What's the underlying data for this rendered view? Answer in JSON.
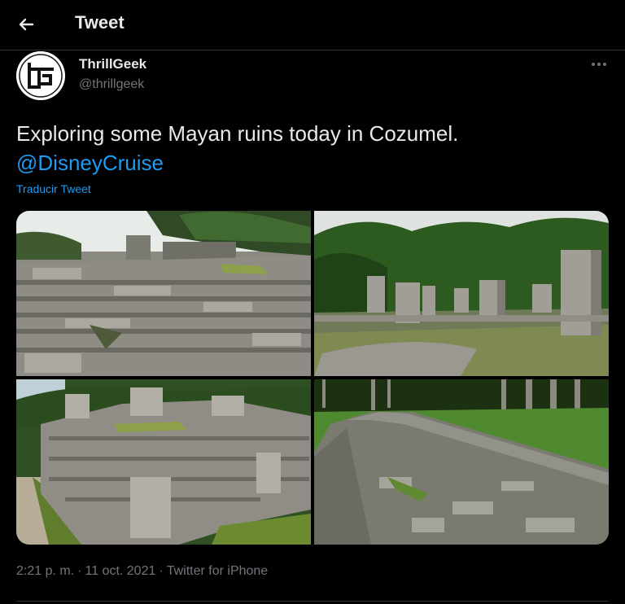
{
  "header": {
    "title": "Tweet",
    "back_icon": "arrow-left-icon"
  },
  "author": {
    "display_name": "ThrillGeek",
    "handle": "@thrillgeek",
    "avatar_text": "tg"
  },
  "more_icon": "more-horizontal-icon",
  "tweet": {
    "text": "Exploring some Mayan ruins today in Cozumel.",
    "mention": "@DisneyCruise",
    "translate_label": "Traducir Tweet"
  },
  "media": {
    "count": 4,
    "photos": [
      "ruins-stone-steps-photo",
      "stone-columns-photo",
      "ruins-wall-photo",
      "stone-path-photo"
    ]
  },
  "meta": {
    "time": "2:21 p. m.",
    "separator": "·",
    "date": "11 oct. 2021",
    "source": "Twitter for iPhone"
  },
  "colors": {
    "background": "#000000",
    "text": "#e7e9ea",
    "secondary": "#71767b",
    "accent": "#1d9bf0",
    "border": "#2f3336"
  }
}
